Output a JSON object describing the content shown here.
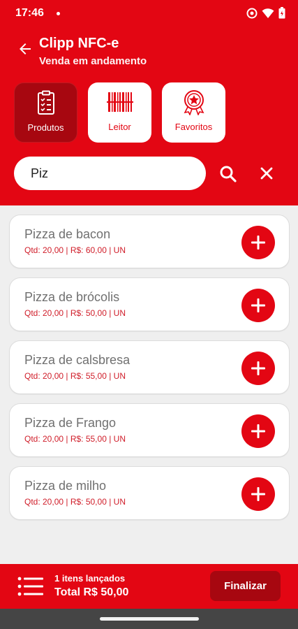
{
  "status_bar": {
    "time": "17:46"
  },
  "header": {
    "title": "Clipp NFC-e",
    "subtitle": "Venda em andamento"
  },
  "tabs": [
    {
      "label": "Produtos",
      "icon": "clipboard-list-icon",
      "active": true
    },
    {
      "label": "Leitor",
      "icon": "barcode-icon",
      "active": false
    },
    {
      "label": "Favoritos",
      "icon": "award-star-icon",
      "active": false
    }
  ],
  "search": {
    "value": "Piz",
    "placeholder": ""
  },
  "products": [
    {
      "name": "Pizza de bacon",
      "info": "Qtd: 20,00 | R$: 60,00 | UN"
    },
    {
      "name": "Pizza de brócolis",
      "info": "Qtd: 20,00 | R$: 50,00 | UN"
    },
    {
      "name": "Pizza de calsbresa",
      "info": "Qtd: 20,00 | R$: 55,00 | UN"
    },
    {
      "name": "Pizza de Frango",
      "info": "Qtd: 20,00 | R$: 55,00 | UN"
    },
    {
      "name": "Pizza de milho",
      "info": "Qtd: 20,00 | R$: 50,00 | UN"
    }
  ],
  "footer": {
    "items_text": "1 itens lançados",
    "total_text": "Total R$ 50,00",
    "finalize_label": "Finalizar"
  },
  "colors": {
    "brand": "#e30613",
    "brand_dark": "#a70710",
    "background": "#efefef"
  }
}
